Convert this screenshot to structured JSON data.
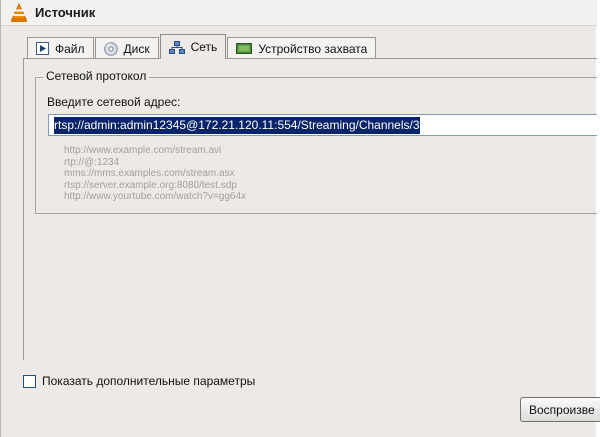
{
  "window": {
    "title": "Источник"
  },
  "tabs": [
    {
      "label": "Файл",
      "icon": "play-file-icon",
      "active": false
    },
    {
      "label": "Диск",
      "icon": "disc-icon",
      "active": false
    },
    {
      "label": "Сеть",
      "icon": "network-icon",
      "active": true
    },
    {
      "label": "Устройство захвата",
      "icon": "capture-device-icon",
      "active": false
    }
  ],
  "network": {
    "group_title": "Сетевой протокол",
    "address_label": "Введите сетевой адрес:",
    "address_value": "rtsp://admin:admin12345@172.21.120.11:554/Streaming/Channels/3",
    "examples": [
      "http://www.example.com/stream.avi",
      "rtp://@:1234",
      "mms://mms.examples.com/stream.asx",
      "rtsp://server.example.org:8080/test.sdp",
      "http://www.yourtube.com/watch?v=gg64x"
    ]
  },
  "options": {
    "show_more_label": "Показать дополнительные параметры",
    "show_more_checked": false
  },
  "footer": {
    "play_label": "Воспроизве"
  },
  "colors": {
    "selection": "#0a246a",
    "window_bg": "#ece9e6",
    "vlc_orange": "#f08a00"
  }
}
